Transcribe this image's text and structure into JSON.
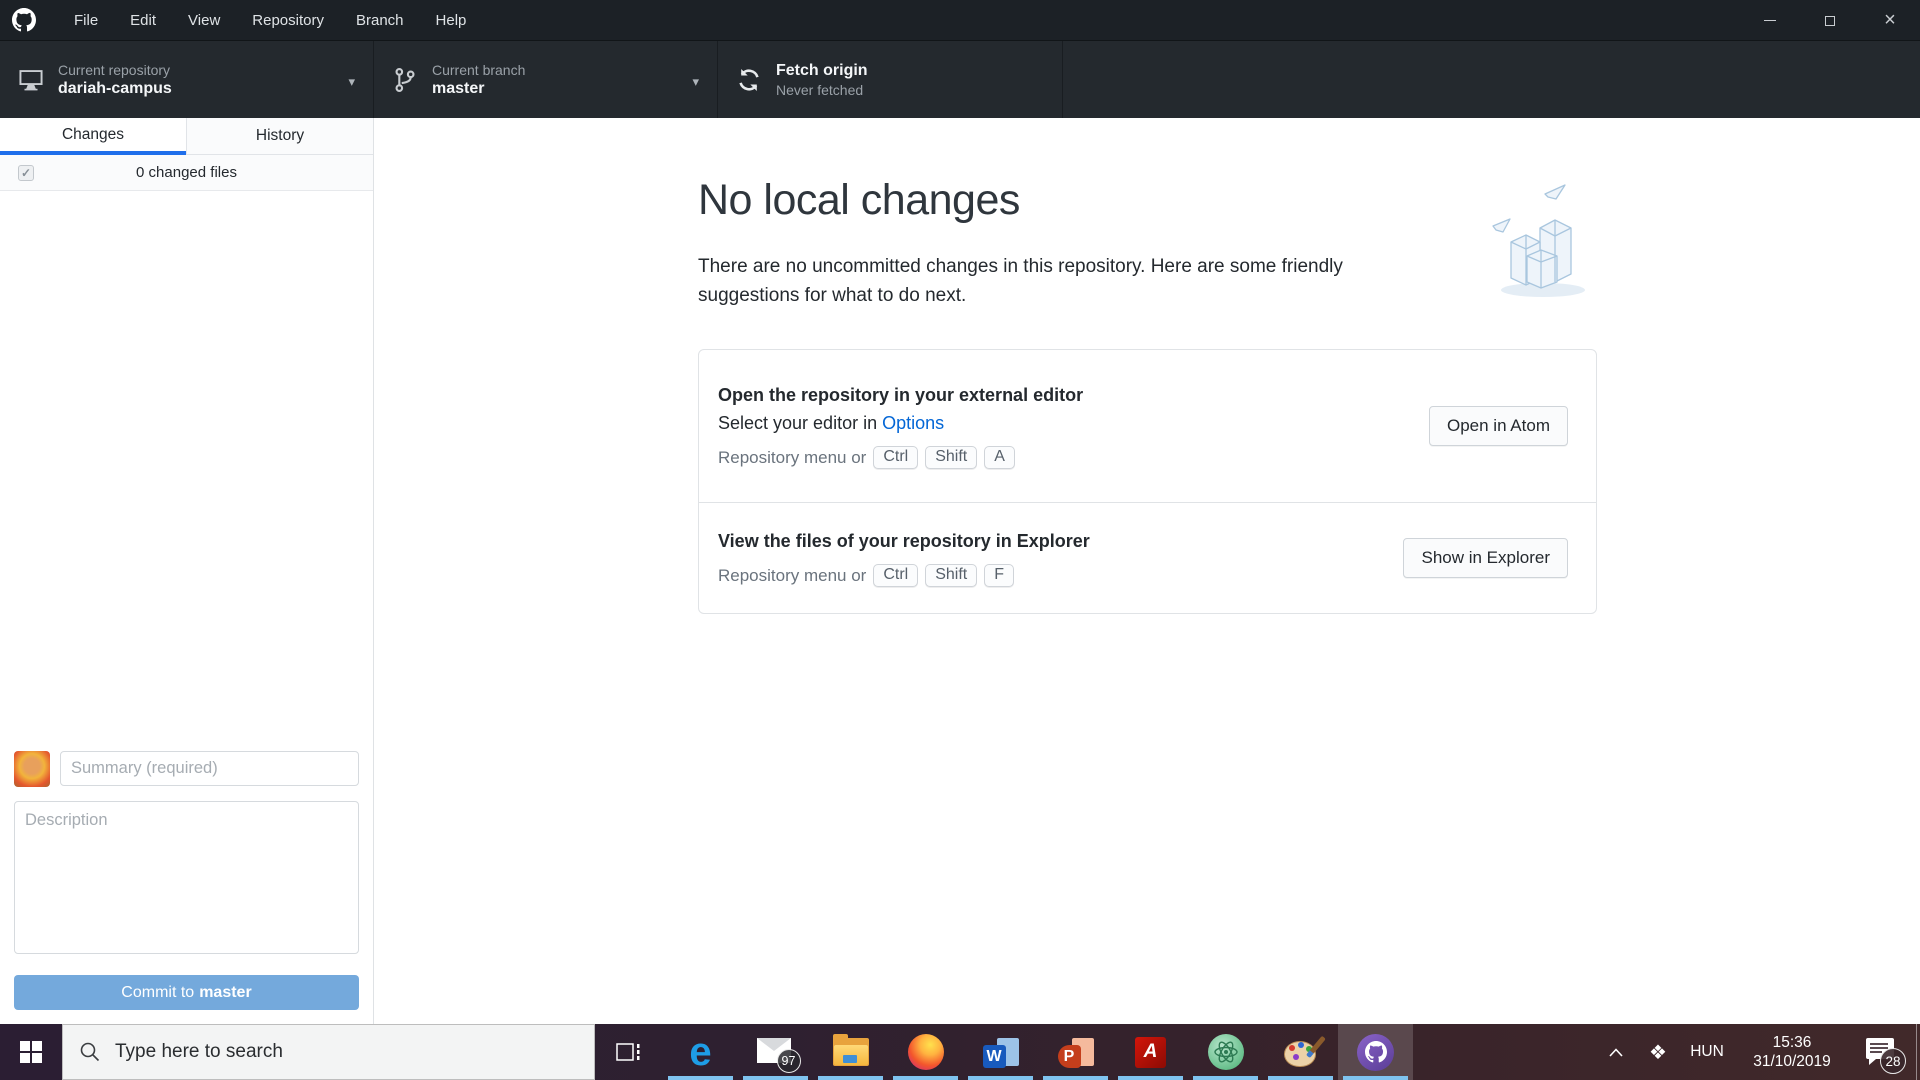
{
  "titlebar": {
    "menu": [
      "File",
      "Edit",
      "View",
      "Repository",
      "Branch",
      "Help"
    ]
  },
  "toolbar": {
    "repository_label": "Current repository",
    "repository_value": "dariah-campus",
    "branch_label": "Current branch",
    "branch_value": "master",
    "fetch_label": "Fetch origin",
    "fetch_status": "Never fetched"
  },
  "sidebar": {
    "tab_changes": "Changes",
    "tab_history": "History",
    "changed_files": "0 changed files",
    "checkbox_glyph": "✓",
    "commit": {
      "summary_placeholder": "Summary (required)",
      "description_placeholder": "Description",
      "button_prefix": "Commit to",
      "button_branch": "master"
    }
  },
  "main": {
    "title": "No local changes",
    "subtitle": "There are no uncommitted changes in this repository. Here are some friendly suggestions for what to do next.",
    "suggestions": [
      {
        "title": "Open the repository in your external editor",
        "line_prefix": "Select your editor in",
        "link": "Options",
        "hint": "Repository menu or",
        "keys": [
          "Ctrl",
          "Shift",
          "A"
        ],
        "button": "Open in Atom"
      },
      {
        "title": "View the files of your repository in Explorer",
        "hint": "Repository menu or",
        "keys": [
          "Ctrl",
          "Shift",
          "F"
        ],
        "button": "Show in Explorer"
      }
    ]
  },
  "taskbar": {
    "search_placeholder": "Type here to search",
    "mail_badge": "97",
    "word_letter": "W",
    "ppt_letter": "P",
    "acrobat_letter": "A",
    "edge_letter": "e",
    "dropbox_glyph": "❖",
    "tray": {
      "language": "HUN",
      "time": "15:36",
      "date": "31/10/2019",
      "notifications": "28"
    }
  },
  "colors": {
    "accent_blue": "#1f6feb",
    "link_blue": "#0366d6",
    "commit_button_blue": "#74a9dc",
    "taskbar_underline": "#7fc3ef",
    "titlebar_bg": "#1c2126",
    "toolbar_bg": "#24292e"
  }
}
